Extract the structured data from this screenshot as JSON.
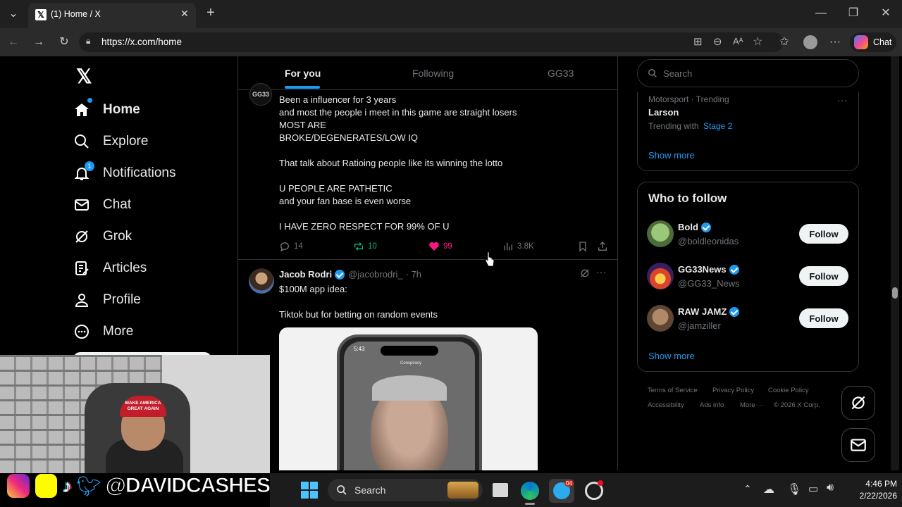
{
  "browser": {
    "tab_title": "(1) Home / X",
    "url": "https://x.com/home",
    "chat_label": "Chat"
  },
  "sidebar": {
    "items": [
      {
        "label": "Home"
      },
      {
        "label": "Explore"
      },
      {
        "label": "Notifications",
        "badge": "1"
      },
      {
        "label": "Chat"
      },
      {
        "label": "Grok"
      },
      {
        "label": "Articles"
      },
      {
        "label": "Profile"
      },
      {
        "label": "More"
      }
    ]
  },
  "feed": {
    "tabs": [
      "For you",
      "Following",
      "GG33"
    ],
    "tweet1": {
      "avatar_text": "GG33",
      "lines": [
        "Been a influencer for 3 years",
        "and most the people i meet in this game are straight losers",
        "MOST ARE",
        "BROKE/DEGENERATES/LOW IQ",
        "",
        "That talk about Ratioing people like its winning the lotto",
        "",
        "U PEOPLE ARE PATHETIC",
        "and your fan base is even worse",
        "",
        "I HAVE ZERO RESPECT FOR 99% OF U"
      ],
      "replies": "14",
      "reposts": "10",
      "likes": "99",
      "views": "3.8K"
    },
    "tweet2": {
      "name": "Jacob Rodri",
      "handle": "@jacobrodri_",
      "time": "· 7h",
      "text1": "$100M app idea:",
      "text2": "Tiktok but for betting on random events",
      "phone_time": "5:43",
      "phone_app": "Conspiracy"
    }
  },
  "right": {
    "search_placeholder": "Search",
    "trend": {
      "meta": "Motorsport · Trending",
      "title": "Larson",
      "with_label": "Trending with",
      "with_link": "Stage 2"
    },
    "show_more": "Show more",
    "who_title": "Who to follow",
    "who": [
      {
        "name": "Bold",
        "handle": "@boldleonidas",
        "btn": "Follow"
      },
      {
        "name": "GG33News",
        "handle": "@GG33_News",
        "btn": "Follow"
      },
      {
        "name": "RAW JAMZ",
        "handle": "@jamziller",
        "btn": "Follow"
      }
    ],
    "show_more2": "Show more",
    "footer": {
      "terms": "Terms of Service",
      "privacy": "Privacy Policy",
      "cookie": "Cookie Policy",
      "access": "Accessibility",
      "ads": "Ads info",
      "more": "More ···",
      "copy": "© 2026 X Corp."
    }
  },
  "overlay": {
    "handle": "@DAVIDCASHES",
    "hat_text": "MAKE AMERICA GREAT AGAIN"
  },
  "taskbar": {
    "search": "Search",
    "time": "4:46 PM",
    "date": "2/22/2026",
    "telegram_badge": "04"
  },
  "colors": {
    "accent": "#1d9bf0",
    "like": "#f91880",
    "repost": "#00ba7c"
  }
}
